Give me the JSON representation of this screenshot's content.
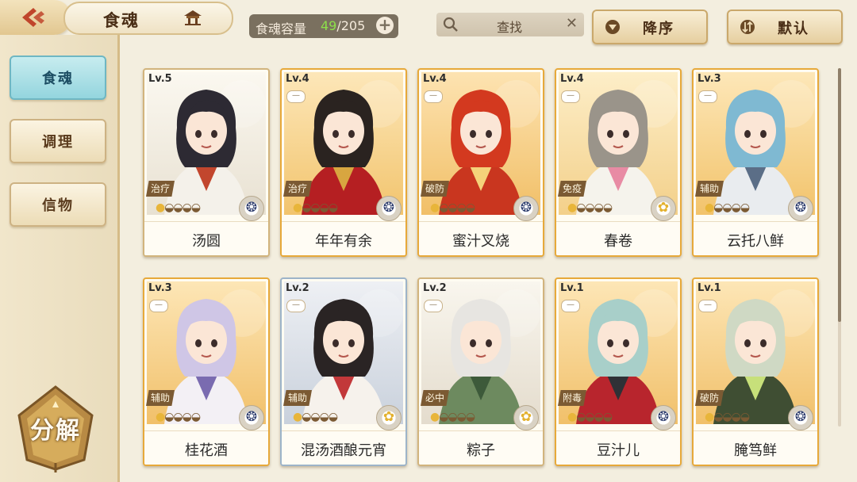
{
  "header": {
    "title": "食魂",
    "capacity_label": "食魂容量",
    "capacity_current": "49",
    "capacity_total": "/205",
    "search_text": "查找",
    "sort_order": "降序",
    "sort_default": "默认"
  },
  "sidebar": {
    "tabs": [
      {
        "label": "食魂",
        "active": true
      },
      {
        "label": "调理",
        "active": false
      },
      {
        "label": "信物",
        "active": false
      }
    ],
    "decompose_label": "分解"
  },
  "cards": [
    {
      "level": "Lv.5",
      "role": "治疗",
      "name": "汤圆",
      "stars": 5,
      "filled": 1,
      "frame": "plain",
      "bg": [
        "#fbf8f0",
        "#e8e1d2"
      ],
      "hair": "#2d2a33",
      "cloth": "#f4f1ea",
      "accent": "#c2462d",
      "emblem": "navy"
    },
    {
      "level": "Lv.4",
      "role": "治疗",
      "name": "年年有余",
      "stars": 5,
      "filled": 1,
      "frame": "gold",
      "bg": [
        "#fde7b9",
        "#f2c46d"
      ],
      "hair": "#2a2320",
      "cloth": "#b51f22",
      "accent": "#d8a640",
      "emblem": "navy"
    },
    {
      "level": "Lv.4",
      "role": "破防",
      "name": "蜜汁叉烧",
      "stars": 5,
      "filled": 1,
      "frame": "gold",
      "bg": [
        "#fde3b1",
        "#f1bf67"
      ],
      "hair": "#d3391f",
      "cloth": "#c9361f",
      "accent": "#f5d27a",
      "emblem": "navy"
    },
    {
      "level": "Lv.4",
      "role": "免疫",
      "name": "春卷",
      "stars": 5,
      "filled": 1,
      "frame": "gold",
      "bg": [
        "#fdeec8",
        "#f3d08a"
      ],
      "hair": "#9a948a",
      "cloth": "#f5f3ec",
      "accent": "#e88ba4",
      "emblem": "gold"
    },
    {
      "level": "Lv.3",
      "role": "辅助",
      "name": "云托八鲜",
      "stars": 5,
      "filled": 1,
      "frame": "gold",
      "bg": [
        "#fde7b8",
        "#f2c36b"
      ],
      "hair": "#7fb9d2",
      "cloth": "#e9ecef",
      "accent": "#5b6e87",
      "emblem": "navy"
    },
    {
      "level": "Lv.3",
      "role": "辅助",
      "name": "桂花酒",
      "stars": 5,
      "filled": 1,
      "frame": "gold",
      "bg": [
        "#fde6b6",
        "#f1c06a"
      ],
      "hair": "#cfc6e6",
      "cloth": "#f3f0f5",
      "accent": "#7a6bb0",
      "emblem": "navy"
    },
    {
      "level": "Lv.2",
      "role": "辅助",
      "name": "混汤酒酿元宵",
      "stars": 5,
      "filled": 1,
      "frame": "blue",
      "bg": [
        "#eef0f4",
        "#c9d1dc"
      ],
      "hair": "#2a2424",
      "cloth": "#f6f2ec",
      "accent": "#c2383a",
      "emblem": "gold"
    },
    {
      "level": "Lv.2",
      "role": "必中",
      "name": "粽子",
      "stars": 5,
      "filled": 1,
      "frame": "plain",
      "bg": [
        "#f9f6ee",
        "#e4dccd"
      ],
      "hair": "#e7e5e1",
      "cloth": "#6d8a5f",
      "accent": "#3d5a3a",
      "emblem": "gold"
    },
    {
      "level": "Lv.1",
      "role": "附毒",
      "name": "豆汁儿",
      "stars": 5,
      "filled": 1,
      "frame": "gold",
      "bg": [
        "#fde6b6",
        "#f1c06a"
      ],
      "hair": "#a8cfc9",
      "cloth": "#b8252d",
      "accent": "#2f3136",
      "emblem": "navy"
    },
    {
      "level": "Lv.1",
      "role": "破防",
      "name": "腌笃鲜",
      "stars": 5,
      "filled": 1,
      "frame": "gold",
      "bg": [
        "#fde6b6",
        "#f1c06a"
      ],
      "hair": "#cfd9c4",
      "cloth": "#3f4e33",
      "accent": "#c7e07a",
      "emblem": "navy"
    }
  ]
}
